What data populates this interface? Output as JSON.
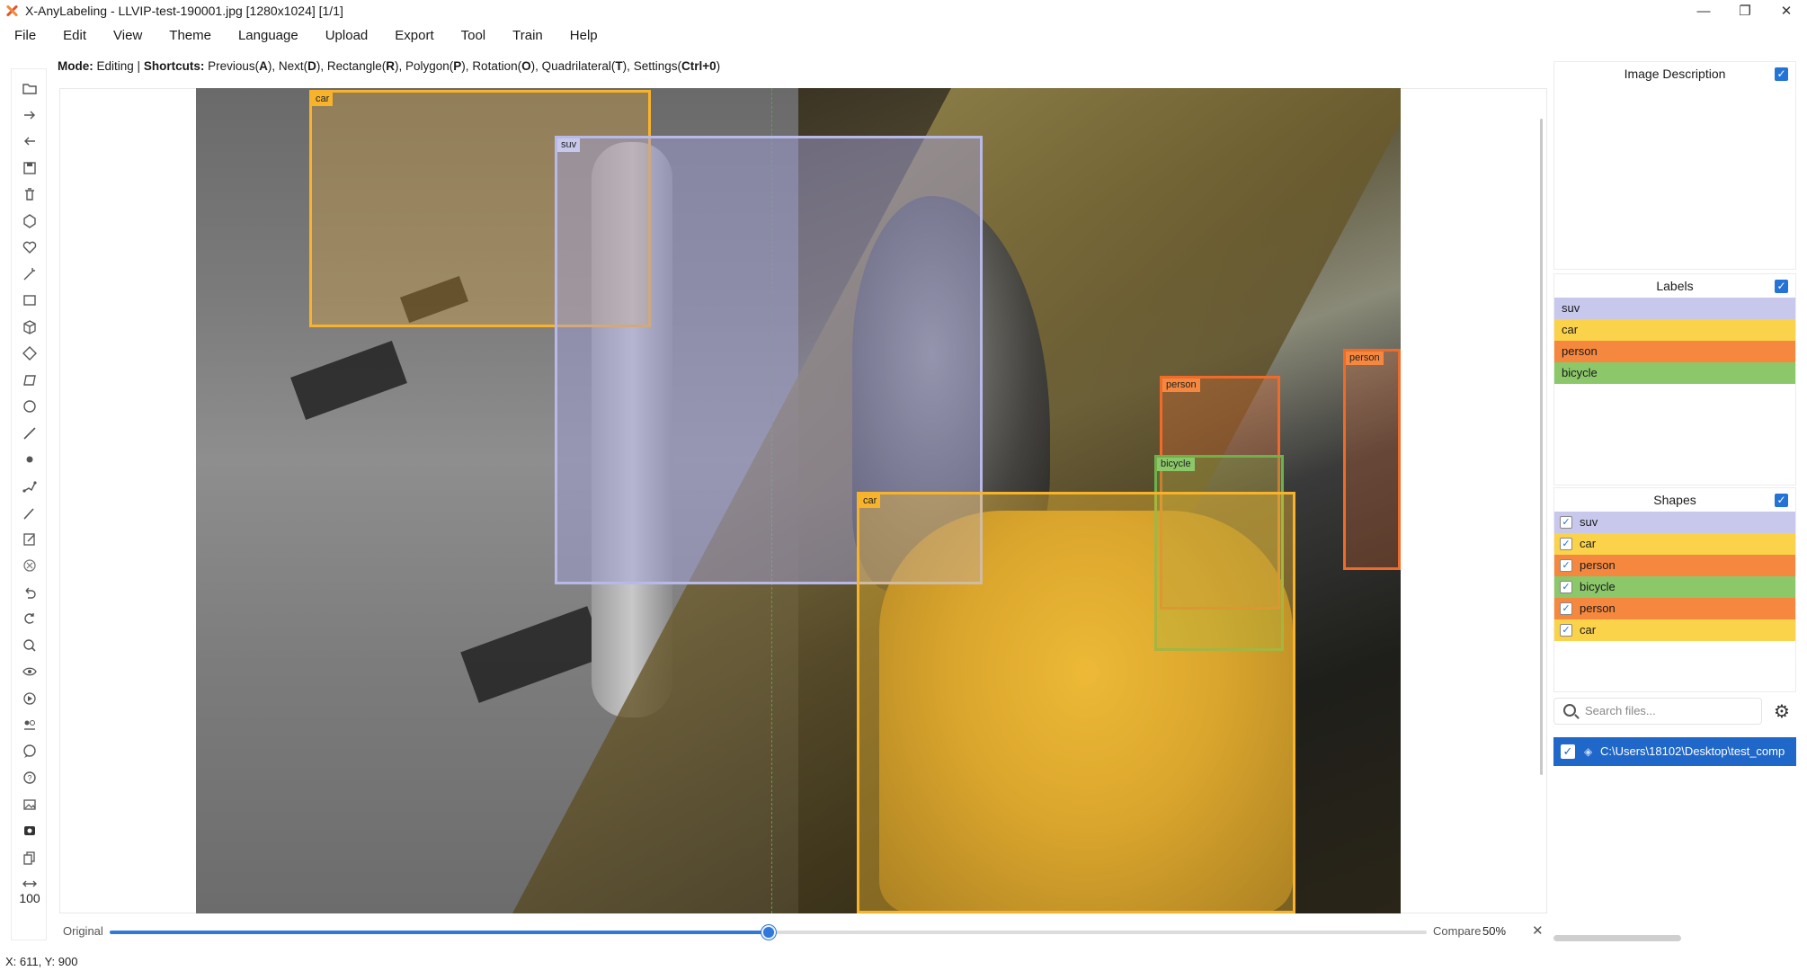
{
  "window": {
    "title": "X-AnyLabeling - LLVIP-test-190001.jpg [1280x1024] [1/1]",
    "controls": [
      "minimize-icon",
      "restore-icon",
      "close-icon"
    ]
  },
  "menu": [
    "File",
    "Edit",
    "View",
    "Theme",
    "Language",
    "Upload",
    "Export",
    "Tool",
    "Train",
    "Help"
  ],
  "modebar": {
    "mode_label": "Mode:",
    "mode_value": "Editing |",
    "shortcuts_label": "Shortcuts:",
    "shortcuts": [
      {
        "text": "Previous(",
        "key": "A",
        "end": "),"
      },
      {
        "text": "Next(",
        "key": "D",
        "end": "),"
      },
      {
        "text": "Rectangle(",
        "key": "R",
        "end": "),"
      },
      {
        "text": "Polygon(",
        "key": "P",
        "end": "),"
      },
      {
        "text": "Rotation(",
        "key": "O",
        "end": "),"
      },
      {
        "text": "Quadrilateral(",
        "key": "T",
        "end": "),"
      },
      {
        "text": "Settings(",
        "key": "Ctrl+0",
        "end": ")"
      }
    ]
  },
  "toolbar": {
    "tools": [
      "open-folder-icon",
      "next-image-icon",
      "prev-image-icon",
      "save-icon",
      "delete-icon",
      "polygon-icon",
      "heart-shape-icon",
      "magic-wand-icon",
      "rectangle-icon",
      "cube-icon",
      "rotation-icon",
      "quadrilateral-icon",
      "circle-icon",
      "line-icon",
      "point-icon",
      "linestrip-icon",
      "brush-icon",
      "edit-icon",
      "clear-icon",
      "undo-icon",
      "redo-icon",
      "ai-icon",
      "visibility-icon",
      "play-icon",
      "group-icon",
      "chat-icon",
      "help-icon",
      "image-icon",
      "video-icon",
      "copy-icon",
      "fit-width-icon"
    ],
    "zoom": "100"
  },
  "canvas": {
    "compare_ratio": 0.5,
    "boxes": [
      {
        "label": "car",
        "color": "#f7b32b"
      },
      {
        "label": "suv",
        "color": "#b9b9e8"
      },
      {
        "label": "person",
        "color": "#f06a2a"
      },
      {
        "label": "person",
        "color": "#f06a2a"
      },
      {
        "label": "bicycle",
        "color": "#6fb04a"
      },
      {
        "label": "car",
        "color": "#f7b32b"
      }
    ]
  },
  "slider": {
    "original_label": "Original",
    "compare_label": "Compare",
    "percent": "50%",
    "value": 50
  },
  "status": {
    "coords": "X: 611, Y: 900"
  },
  "panels": {
    "description": {
      "title": "Image Description"
    },
    "labels": {
      "title": "Labels",
      "items": [
        {
          "name": "suv",
          "color": "#c8c8ec"
        },
        {
          "name": "car",
          "color": "#fbd34a"
        },
        {
          "name": "person",
          "color": "#f5883e"
        },
        {
          "name": "bicycle",
          "color": "#8cc86a"
        }
      ]
    },
    "shapes": {
      "title": "Shapes",
      "items": [
        {
          "name": "suv",
          "color": "#c8c8ec"
        },
        {
          "name": "car",
          "color": "#fbd34a"
        },
        {
          "name": "person",
          "color": "#f5883e"
        },
        {
          "name": "bicycle",
          "color": "#8cc86a"
        },
        {
          "name": "person",
          "color": "#f5883e"
        },
        {
          "name": "car",
          "color": "#fbd34a"
        }
      ]
    },
    "search": {
      "placeholder": "Search files..."
    },
    "file": {
      "path": "C:\\Users\\18102\\Desktop\\test_comp"
    }
  }
}
